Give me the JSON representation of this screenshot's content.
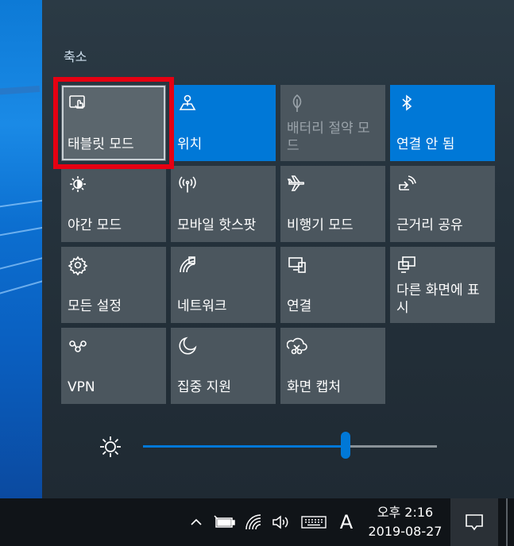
{
  "panel": {
    "collapse_label": "축소"
  },
  "tiles": [
    {
      "label": "태블릿 모드",
      "icon": "tablet-mode-icon",
      "state": "selected"
    },
    {
      "label": "위치",
      "icon": "location-icon",
      "state": "on"
    },
    {
      "label": "배터리 절약 모드",
      "icon": "battery-saver-icon",
      "state": "disabled"
    },
    {
      "label": "연결 안 됨",
      "icon": "bluetooth-icon",
      "state": "on"
    },
    {
      "label": "야간 모드",
      "icon": "night-light-icon",
      "state": "off"
    },
    {
      "label": "모바일 핫스팟",
      "icon": "mobile-hotspot-icon",
      "state": "off"
    },
    {
      "label": "비행기 모드",
      "icon": "airplane-icon",
      "state": "off"
    },
    {
      "label": "근거리 공유",
      "icon": "nearby-share-icon",
      "state": "off"
    },
    {
      "label": "모든 설정",
      "icon": "settings-gear-icon",
      "state": "off"
    },
    {
      "label": "네트워크",
      "icon": "network-icon",
      "state": "off"
    },
    {
      "label": "연결",
      "icon": "connect-icon",
      "state": "off"
    },
    {
      "label": "다른 화면에 표시",
      "icon": "project-icon",
      "state": "off"
    },
    {
      "label": "VPN",
      "icon": "vpn-icon",
      "state": "off"
    },
    {
      "label": "집중 지원",
      "icon": "focus-assist-moon-icon",
      "state": "off"
    },
    {
      "label": "화면 캡처",
      "icon": "screen-snip-icon",
      "state": "off"
    }
  ],
  "brightness": {
    "value": 0.69,
    "icon": "brightness-sun-icon"
  },
  "taskbar": {
    "input_indicator": "A",
    "clock_time": "오후 2:16",
    "clock_date": "2019-08-27",
    "icons": [
      "chevron-up-icon",
      "battery-icon",
      "wifi-icon",
      "volume-icon",
      "keyboard-icon"
    ]
  },
  "colors": {
    "accent": "#0078d7",
    "tile": "#4b565e",
    "highlight": "#e60012"
  }
}
